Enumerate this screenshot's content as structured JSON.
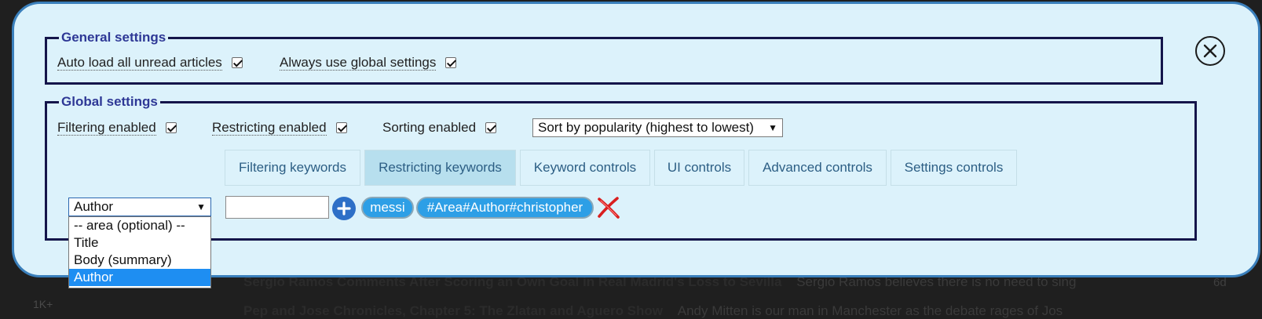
{
  "background": {
    "article1_title": "Sergio Ramos Comments After Scoring an Own Goal in Real Madrid's Loss to Sevilla",
    "article1_snippet": "Sergio Ramos believes there is no need to sing",
    "article1_age": "6d",
    "article2_title": "Pep and Jose Chronicles, Chapter 5: The Zlatan and Aguero Show",
    "article2_snippet": "Andy Mitten is our man in Manchester as the debate rages of Jos",
    "side_count": "1K+"
  },
  "general": {
    "legend": "General settings",
    "auto_load_label": "Auto load all unread articles",
    "auto_load_checked": true,
    "always_global_label": "Always use global settings",
    "always_global_checked": true
  },
  "global": {
    "legend": "Global settings",
    "filtering_label": "Filtering enabled",
    "filtering_checked": true,
    "restricting_label": "Restricting enabled",
    "restricting_checked": true,
    "sorting_label": "Sorting enabled",
    "sorting_checked": true,
    "sort_value": "Sort by popularity (highest to lowest)"
  },
  "tabs": [
    {
      "label": "Filtering keywords",
      "active": false
    },
    {
      "label": "Restricting keywords",
      "active": true
    },
    {
      "label": "Keyword controls",
      "active": false
    },
    {
      "label": "UI controls",
      "active": false
    },
    {
      "label": "Advanced controls",
      "active": false
    },
    {
      "label": "Settings controls",
      "active": false
    }
  ],
  "keywords": {
    "area_value": "Author",
    "area_options": [
      "-- area (optional) --",
      "Title",
      "Body (summary)",
      "Author"
    ],
    "input_value": "",
    "chips": [
      "messi",
      "#Area#Author#christopher"
    ]
  },
  "colors": {
    "modal_bg": "#dcf2fb",
    "modal_border": "#3a7fbb",
    "legend_text": "#2e3896",
    "chip_bg": "#2d9fe6",
    "selected_option_bg": "#1e8ef2",
    "delete_icon": "#d91f1f"
  },
  "icons": {
    "close": "close-circle-icon",
    "add": "plus-circle-icon",
    "delete": "red-x-icon",
    "dropdown": "caret-down-icon"
  }
}
